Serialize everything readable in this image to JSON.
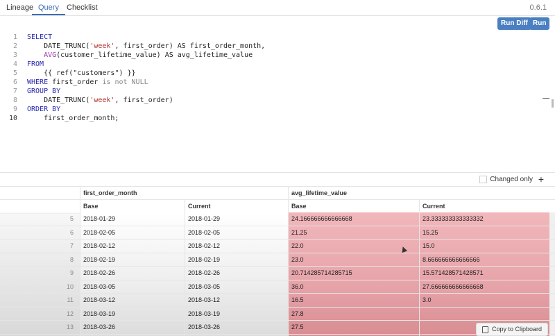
{
  "tabs": [
    "Lineage",
    "Query",
    "Checklist"
  ],
  "version": "0.6.1",
  "editor": {
    "run_diff_label": "Run Diff",
    "run_label": "Run",
    "lines": [
      {
        "n": "1",
        "parts": [
          [
            "kw",
            "SELECT"
          ]
        ]
      },
      {
        "n": "2",
        "parts": [
          [
            "t",
            "    DATE_TRUNC("
          ],
          [
            "str",
            "'week'"
          ],
          [
            "t",
            ", first_order) AS first_order_month,"
          ]
        ]
      },
      {
        "n": "3",
        "parts": [
          [
            "t",
            "    "
          ],
          [
            "fn",
            "AVG"
          ],
          [
            "t",
            "(customer_lifetime_value) AS avg_lifetime_value"
          ]
        ]
      },
      {
        "n": "4",
        "parts": [
          [
            "kw",
            "FROM"
          ]
        ]
      },
      {
        "n": "5",
        "parts": [
          [
            "t",
            "    {{ ref(\"customers\") }}"
          ]
        ]
      },
      {
        "n": "6",
        "parts": [
          [
            "kw",
            "WHERE"
          ],
          [
            "t",
            " first_order "
          ],
          [
            "cm",
            "is not NULL"
          ]
        ]
      },
      {
        "n": "7",
        "parts": [
          [
            "kw",
            "GROUP BY"
          ]
        ]
      },
      {
        "n": "8",
        "parts": [
          [
            "t",
            "    DATE_TRUNC("
          ],
          [
            "str",
            "'week'"
          ],
          [
            "t",
            ", first_order)"
          ]
        ]
      },
      {
        "n": "9",
        "parts": [
          [
            "kw",
            "ORDER BY"
          ]
        ]
      },
      {
        "n": "10",
        "parts": [
          [
            "t",
            "    first_order_month;"
          ]
        ]
      }
    ]
  },
  "results": {
    "changed_only_label": "Changed only",
    "add_icon": "+",
    "headers": {
      "col1": "first_order_month",
      "col2": "avg_lifetime_value",
      "base": "Base",
      "current": "Current"
    },
    "rows": [
      {
        "n": "5",
        "fom_base": "2018-01-29",
        "fom_current": "2018-01-29",
        "alv_base": "24.166666666666668",
        "alv_current": "23.333333333333332"
      },
      {
        "n": "6",
        "fom_base": "2018-02-05",
        "fom_current": "2018-02-05",
        "alv_base": "21.25",
        "alv_current": "15.25"
      },
      {
        "n": "7",
        "fom_base": "2018-02-12",
        "fom_current": "2018-02-12",
        "alv_base": "22.0",
        "alv_current": "15.0"
      },
      {
        "n": "8",
        "fom_base": "2018-02-19",
        "fom_current": "2018-02-19",
        "alv_base": "23.0",
        "alv_current": "8.666666666666666"
      },
      {
        "n": "9",
        "fom_base": "2018-02-26",
        "fom_current": "2018-02-26",
        "alv_base": "20.714285714285715",
        "alv_current": "15.571428571428571"
      },
      {
        "n": "10",
        "fom_base": "2018-03-05",
        "fom_current": "2018-03-05",
        "alv_base": "36.0",
        "alv_current": "27.666666666666668"
      },
      {
        "n": "11",
        "fom_base": "2018-03-12",
        "fom_current": "2018-03-12",
        "alv_base": "16.5",
        "alv_current": "3.0"
      },
      {
        "n": "12",
        "fom_base": "2018-03-19",
        "fom_current": "2018-03-19",
        "alv_base": "27.8",
        "alv_current": ""
      },
      {
        "n": "13",
        "fom_base": "2018-03-26",
        "fom_current": "2018-03-26",
        "alv_base": "27.5",
        "alv_current": ""
      }
    ],
    "copy_label": "Copy to Clipboard"
  },
  "colors": {
    "accent": "#3a6fb5",
    "button": "#4a7fc1",
    "diff_red": "#f1b7bb"
  }
}
